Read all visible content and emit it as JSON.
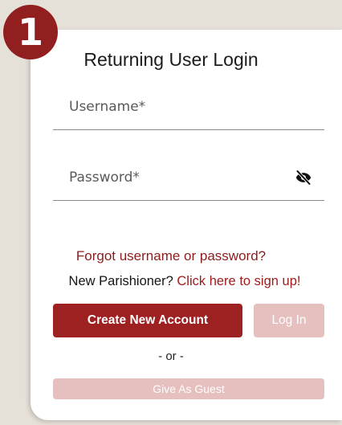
{
  "step": {
    "number": "1"
  },
  "login": {
    "title": "Returning User Login",
    "username": {
      "placeholder": "Username*",
      "value": ""
    },
    "password": {
      "placeholder": "Password*",
      "value": "",
      "toggle_icon": "eye-slash-icon"
    },
    "forgot_link": "Forgot username or password?",
    "new_parishioner_prefix": "New Parishioner?",
    "signup_link": "Click here to sign up!",
    "create_account_label": "Create New Account",
    "login_label": "Log In",
    "or_text": "- or -",
    "guest_label": "Give As Guest"
  },
  "colors": {
    "brand": "#9e2121",
    "brand_disabled": "#e6bfbf",
    "link": "#8b1c1c",
    "background": "#e6e1d8"
  }
}
